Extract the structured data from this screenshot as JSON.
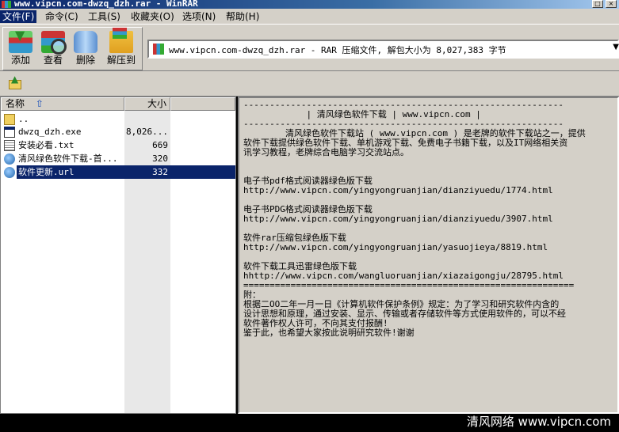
{
  "window": {
    "title": "www.vipcn.com-dwzq_dzh.rar - WinRAR"
  },
  "menu": {
    "items": [
      {
        "label": "文件(F)"
      },
      {
        "label": "命令(C)"
      },
      {
        "label": "工具(S)"
      },
      {
        "label": "收藏夹(O)"
      },
      {
        "label": "选项(N)"
      },
      {
        "label": "帮助(H)"
      }
    ]
  },
  "toolbar": {
    "add_label": "添加",
    "view_label": "查看",
    "delete_label": "删除",
    "extract_label": "解压到"
  },
  "path": {
    "text": "www.vipcn.com-dwzq_dzh.rar - RAR 压缩文件, 解包大小为 8,027,383 字节"
  },
  "file_list": {
    "headers": {
      "name": "名称",
      "size": "大小"
    },
    "rows": [
      {
        "name": "..",
        "size": ""
      },
      {
        "name": "dwzq_dzh.exe",
        "size": "8,026..."
      },
      {
        "name": "安装必看.txt",
        "size": "669"
      },
      {
        "name": "清风绿色软件下载-首...",
        "size": "320"
      },
      {
        "name": "软件更新.url",
        "size": "332"
      }
    ]
  },
  "comment": {
    "text": "-------------------------------------------------------------\n            | 清风绿色软件下载 | www.vipcn.com |\n-------------------------------------------------------------\n        清风绿色软件下载站 ( www.vipcn.com ) 是老牌的软件下载站之一，提供\n软件下载提供绿色软件下载、单机游戏下载、免费电子书籍下载，以及IT网络相关资\n讯学习教程，老牌综合电脑学习交流站点。\n\n\n电子书pdf格式阅读器绿色版下载\nhttp://www.vipcn.com/yingyongruanjian/dianziyuedu/1774.html\n\n电子书PDG格式阅读器绿色版下载\nhttp://www.vipcn.com/yingyongruanjian/dianziyuedu/3907.html\n\n软件rar压缩包绿色版下载\nhttp://www.vipcn.com/yingyongruanjian/yasuojieya/8819.html\n\n软件下载工具迅雷绿色版下载\nhhttp://www.vipcn.com/wangluoruanjian/xiazaigongju/28795.html\n===============================================================\n附：\n根据二OO二年一月一日《计算机软件保护条例》规定：为了学习和研究软件内含的\n设计思想和原理，通过安装、显示、传输或者存储软件等方式使用软件的，可以不经\n软件著作权人许可，不向其支付报酬!\n鉴于此，也希望大家按此说明研究软件!谢谢"
  },
  "watermark": {
    "text": "清风网络 www.vipcn.com"
  }
}
